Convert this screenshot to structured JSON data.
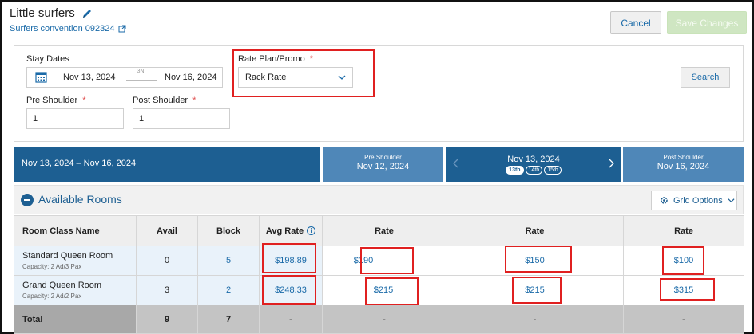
{
  "header": {
    "title": "Little surfers",
    "subtitle": "Surfers convention 092324",
    "cancel_label": "Cancel",
    "save_label": "Save Changes"
  },
  "filters": {
    "stay_dates_label": "Stay Dates",
    "start_date": "Nov 13, 2024",
    "nights": "3N",
    "end_date": "Nov 16, 2024",
    "rate_plan_label": "Rate Plan/Promo",
    "rate_plan_value": "Rack Rate",
    "search_label": "Search",
    "pre_shoulder_label": "Pre Shoulder",
    "pre_shoulder_value": "1",
    "post_shoulder_label": "Post Shoulder",
    "post_shoulder_value": "1",
    "required_mark": "*"
  },
  "date_bar": {
    "range": "Nov 13, 2024 – Nov 16, 2024",
    "pre_label": "Pre Shoulder",
    "pre_date": "Nov 12, 2024",
    "current_date": "Nov 13, 2024",
    "day_pills": [
      "13th",
      "14th",
      "15th"
    ],
    "post_label": "Post Shoulder",
    "post_date": "Nov 16, 2024"
  },
  "available": {
    "title": "Available Rooms",
    "grid_options_label": "Grid Options"
  },
  "table": {
    "headers": [
      "Room Class Name",
      "Avail",
      "Block",
      "Avg Rate",
      "Rate",
      "Rate",
      "Rate"
    ],
    "rows": [
      {
        "name": "Standard Queen Room",
        "capacity": "Capacity: 2 Ad/3 Pax",
        "avail": "0",
        "block": "5",
        "avg_rate": "$198.89",
        "pre_rate": "$190",
        "cur_rate": "$150",
        "post_rate": "$100"
      },
      {
        "name": "Grand Queen Room",
        "capacity": "Capacity: 2 Ad/2 Pax",
        "avail": "3",
        "block": "2",
        "avg_rate": "$248.33",
        "pre_rate": "$215",
        "cur_rate": "$215",
        "post_rate": "$315"
      }
    ],
    "total": {
      "label": "Total",
      "avail": "9",
      "block": "7",
      "avg_rate": "-",
      "pre_rate": "-",
      "cur_rate": "-",
      "post_rate": "-"
    }
  },
  "colors": {
    "accent": "#1d5f92",
    "link": "#1a6aa8",
    "highlight": "#e02020",
    "save_disabled": "#cfe6c2"
  }
}
